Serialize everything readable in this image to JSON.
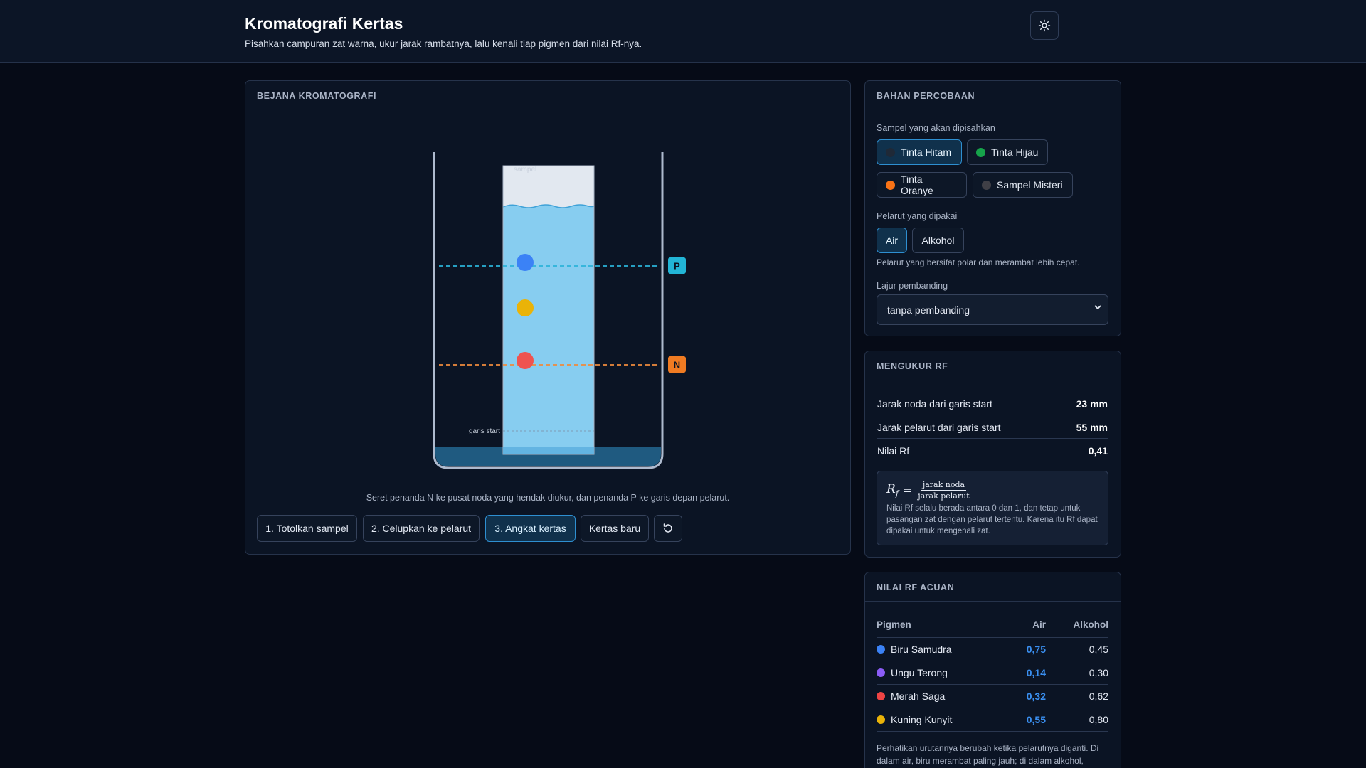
{
  "header": {
    "title": "Kromatografi Kertas",
    "subtitle": "Pisahkan campuran zat warna, ukur jarak rambatnya, lalu kenali tiap pigmen dari nilai Rf-nya."
  },
  "vessel_panel": {
    "title": "BEJANA KROMATOGRAFI",
    "sample_label": "sampel",
    "start_line_label": "garis start",
    "marker_p": "P",
    "marker_n": "N",
    "instruction": "Seret penanda N ke pusat noda yang hendak diukur, dan penanda P ke garis depan pelarut.",
    "spots": [
      {
        "pigment": "Biru Samudra",
        "color": "#3b82f6"
      },
      {
        "pigment": "Kuning Kunyit",
        "color": "#eab308"
      },
      {
        "pigment": "Merah Saga",
        "color": "#ef4444"
      }
    ],
    "buttons": {
      "spot": "1. Totolkan sampel",
      "dip": "2. Celupkan ke pelarut",
      "lift": "3. Angkat kertas",
      "new_paper": "Kertas baru"
    }
  },
  "materials": {
    "title": "BAHAN PERCOBAAN",
    "sample_label": "Sampel yang akan dipisahkan",
    "samples": [
      {
        "label": "Tinta Hitam",
        "color": "#1f2937",
        "selected": true
      },
      {
        "label": "Tinta Hijau",
        "color": "#16a34a",
        "selected": false
      },
      {
        "label": "Tinta Oranye",
        "color": "#f97316",
        "selected": false
      },
      {
        "label": "Sampel Misteri",
        "color": "#3f3f46",
        "selected": false
      }
    ],
    "solvent_label": "Pelarut yang dipakai",
    "solvents": [
      {
        "label": "Air",
        "selected": true
      },
      {
        "label": "Alkohol",
        "selected": false
      }
    ],
    "solvent_hint": "Pelarut yang bersifat polar dan merambat lebih cepat.",
    "compare_label": "Lajur pembanding",
    "compare_value": "tanpa pembanding"
  },
  "measure": {
    "title": "MENGUKUR RF",
    "rows": [
      {
        "label": "Jarak noda dari garis start",
        "value": "23 mm"
      },
      {
        "label": "Jarak pelarut dari garis start",
        "value": "55 mm"
      },
      {
        "label": "Nilai Rf",
        "value": "0,41"
      }
    ],
    "formula_symbol": "R",
    "formula_sub": "f",
    "formula_num": "jarak noda",
    "formula_den": "jarak pelarut",
    "formula_note": "Nilai Rf selalu berada antara 0 dan 1, dan tetap untuk pasangan zat dengan pelarut tertentu. Karena itu Rf dapat dipakai untuk mengenali zat."
  },
  "reference": {
    "title": "NILAI RF ACUAN",
    "columns": [
      "Pigmen",
      "Air",
      "Alkohol"
    ],
    "rows": [
      {
        "name": "Biru Samudra",
        "color": "#3b82f6",
        "air": "0,75",
        "alkohol": "0,45"
      },
      {
        "name": "Ungu Terong",
        "color": "#8b5cf6",
        "air": "0,14",
        "alkohol": "0,30"
      },
      {
        "name": "Merah Saga",
        "color": "#ef4444",
        "air": "0,32",
        "alkohol": "0,62"
      },
      {
        "name": "Kuning Kunyit",
        "color": "#eab308",
        "air": "0,55",
        "alkohol": "0,80"
      }
    ],
    "note": "Perhatikan urutannya berubah ketika pelarutnya diganti. Di dalam air, biru merambat paling jauh; di dalam alkohol,"
  }
}
